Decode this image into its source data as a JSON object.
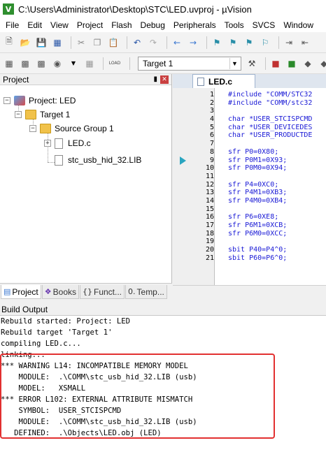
{
  "window": {
    "title": "C:\\Users\\Administrator\\Desktop\\STC\\LED.uvproj - µVision",
    "app_icon": "V"
  },
  "menu": [
    "File",
    "Edit",
    "View",
    "Project",
    "Flash",
    "Debug",
    "Peripherals",
    "Tools",
    "SVCS",
    "Window"
  ],
  "toolbar": {
    "target": "Target 1",
    "load_label": "LOAD"
  },
  "project_pane": {
    "title": "Project",
    "tree": [
      {
        "label": "Project: LED",
        "type": "project"
      },
      {
        "label": "Target 1",
        "type": "target"
      },
      {
        "label": "Source Group 1",
        "type": "group"
      },
      {
        "label": "LED.c",
        "type": "file"
      },
      {
        "label": "stc_usb_hid_32.LIB",
        "type": "file"
      }
    ],
    "tabs": [
      "Project",
      "Books",
      "Funct...",
      "Temp..."
    ]
  },
  "editor": {
    "tab": "LED.c",
    "lines": [
      {
        "n": "1",
        "code": "#include \"COMM/STC32"
      },
      {
        "n": "2",
        "code": "#include \"COMM/stc32"
      },
      {
        "n": "3",
        "code": ""
      },
      {
        "n": "4",
        "code": "char *USER_STCISPCMD"
      },
      {
        "n": "5",
        "code": "char *USER_DEVICEDES"
      },
      {
        "n": "6",
        "code": "char *USER_PRODUCTDE"
      },
      {
        "n": "7",
        "code": ""
      },
      {
        "n": "8",
        "code": "sfr P0=0X80;"
      },
      {
        "n": "9",
        "code": "sfr P0M1=0X93;"
      },
      {
        "n": "10",
        "code": "sfr P0M0=0X94;"
      },
      {
        "n": "11",
        "code": ""
      },
      {
        "n": "12",
        "code": "sfr P4=0XC0;"
      },
      {
        "n": "13",
        "code": "sfr P4M1=0XB3;"
      },
      {
        "n": "14",
        "code": "sfr P4M0=0XB4;"
      },
      {
        "n": "15",
        "code": ""
      },
      {
        "n": "16",
        "code": "sfr P6=0XE8;"
      },
      {
        "n": "17",
        "code": "sfr P6M1=0XCB;"
      },
      {
        "n": "18",
        "code": "sfr P6M0=0XCC;"
      },
      {
        "n": "19",
        "code": ""
      },
      {
        "n": "20",
        "code": "sbit P40=P4^0;"
      },
      {
        "n": "21",
        "code": "sbit P60=P6^0;"
      }
    ]
  },
  "build_output": {
    "title": "Build Output",
    "lines": [
      "Rebuild started: Project: LED",
      "Rebuild target 'Target 1'",
      "compiling LED.c...",
      "linking...",
      "*** WARNING L14: INCOMPATIBLE MEMORY MODEL",
      "    MODULE:  .\\COMM\\stc_usb_hid_32.LIB (usb)",
      "    MODEL:   XSMALL",
      "*** ERROR L102: EXTERNAL ATTRIBUTE MISMATCH",
      "    SYMBOL:  USER_STCISPCMD",
      "    MODULE:  .\\COMM\\stc_usb_hid_32.LIB (usb)",
      "   DEFINED:  .\\Objects\\LED.obj (LED)"
    ]
  },
  "colors": {
    "code_text": "#1a1ad6",
    "highlight_box": "#e23030",
    "marker": "#2aa5c0"
  }
}
